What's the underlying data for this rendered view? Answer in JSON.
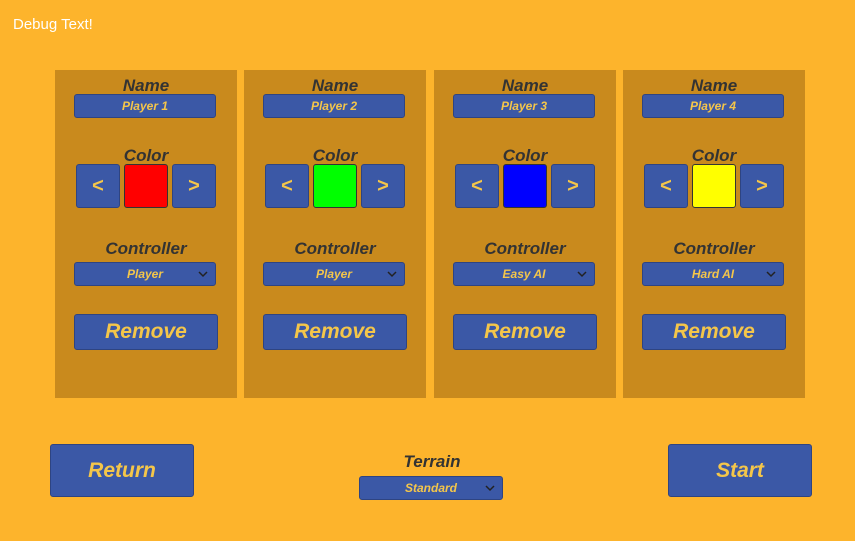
{
  "debug_text": "Debug Text!",
  "labels": {
    "name": "Name",
    "color": "Color",
    "controller": "Controller",
    "terrain": "Terrain"
  },
  "players": [
    {
      "name": "Player 1",
      "color": "#FF0000",
      "controller": "Player",
      "remove": "Remove"
    },
    {
      "name": "Player 2",
      "color": "#00FF00",
      "controller": "Player",
      "remove": "Remove"
    },
    {
      "name": "Player 3",
      "color": "#0000FF",
      "controller": "Easy AI",
      "remove": "Remove"
    },
    {
      "name": "Player 4",
      "color": "#FFFF00",
      "controller": "Hard AI",
      "remove": "Remove"
    }
  ],
  "color_buttons": {
    "prev": "<",
    "next": ">"
  },
  "terrain": {
    "value": "Standard"
  },
  "nav": {
    "return": "Return",
    "start": "Start"
  },
  "theme": {
    "background": "#FDB42C",
    "panel": "#C98A1D",
    "button": "#3B58A6",
    "button_text": "#F4C64A"
  }
}
